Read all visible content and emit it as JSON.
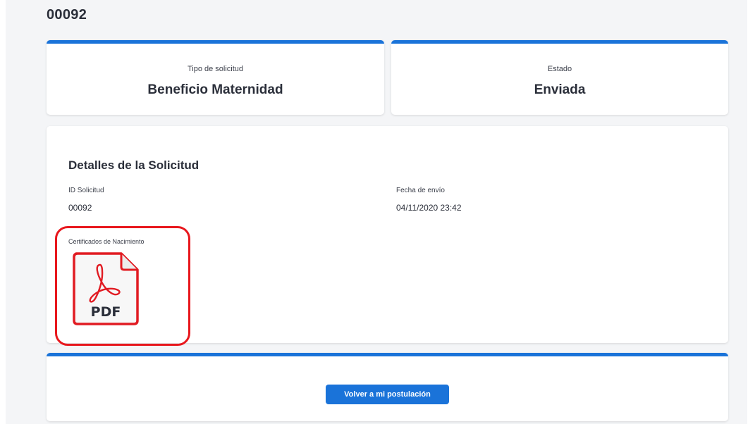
{
  "page": {
    "title": "00092"
  },
  "summary": {
    "type_label": "Tipo de solicitud",
    "type_value": "Beneficio Maternidad",
    "state_label": "Estado",
    "state_value": "Enviada"
  },
  "details": {
    "heading": "Detalles de la Solicitud",
    "id_label": "ID Solicitud",
    "id_value": "00092",
    "date_label": "Fecha de envío",
    "date_value": "04/11/2020 23:42",
    "certificates_label": "Certificados de Nacimiento",
    "file_badge": "PDF",
    "file_icon": "adobe-pdf-icon"
  },
  "actions": {
    "back_button": "Volver a mi postulación"
  },
  "colors": {
    "accent": "#1a73d9",
    "highlight": "#e8171d",
    "pdf_red": "#e11b22"
  }
}
